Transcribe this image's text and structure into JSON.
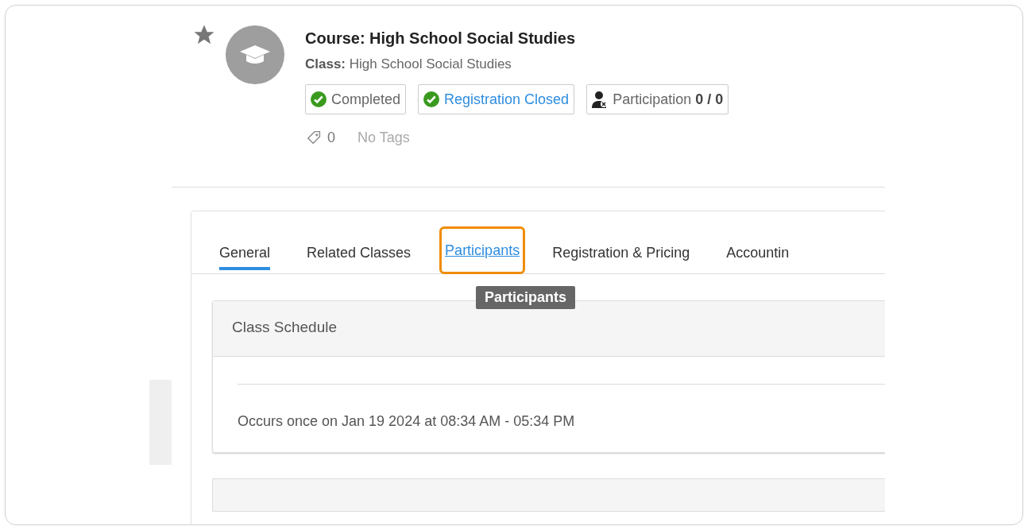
{
  "header": {
    "starred": true,
    "title": "Course: High School Social Studies",
    "class_label": "Class:",
    "class_value": "High School Social Studies",
    "badges": [
      {
        "kind": "status",
        "label": "Completed"
      },
      {
        "kind": "link",
        "label": "Registration Closed"
      },
      {
        "kind": "participation",
        "label": "Participation",
        "value": "0 / 0"
      }
    ],
    "tag_count": "0",
    "tags_text": "No Tags"
  },
  "tabs": [
    {
      "label": "General",
      "selected": true,
      "highlighted": false
    },
    {
      "label": "Related Classes",
      "selected": false,
      "highlighted": false
    },
    {
      "label": "Participants",
      "selected": false,
      "highlighted": true
    },
    {
      "label": "Registration & Pricing",
      "selected": false,
      "highlighted": false
    },
    {
      "label": "Accountin",
      "selected": false,
      "highlighted": false
    }
  ],
  "tooltip": "Participants",
  "schedule": {
    "title": "Class Schedule",
    "text": "Occurs once on Jan 19 2024 at 08:34 AM - 05:34 PM"
  }
}
